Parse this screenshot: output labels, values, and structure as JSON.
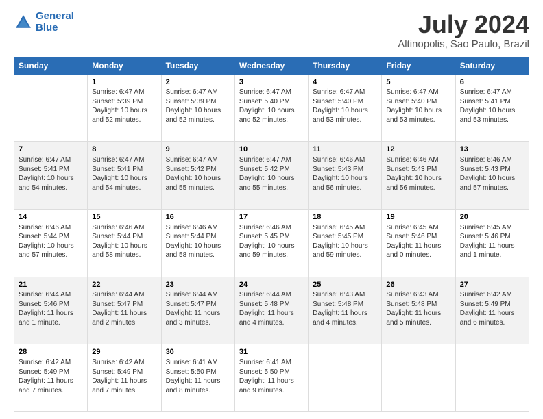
{
  "header": {
    "logo_line1": "General",
    "logo_line2": "Blue",
    "month_year": "July 2024",
    "location": "Altinopolis, Sao Paulo, Brazil"
  },
  "days_of_week": [
    "Sunday",
    "Monday",
    "Tuesday",
    "Wednesday",
    "Thursday",
    "Friday",
    "Saturday"
  ],
  "weeks": [
    [
      {
        "day": "",
        "info": ""
      },
      {
        "day": "1",
        "info": "Sunrise: 6:47 AM\nSunset: 5:39 PM\nDaylight: 10 hours\nand 52 minutes."
      },
      {
        "day": "2",
        "info": "Sunrise: 6:47 AM\nSunset: 5:39 PM\nDaylight: 10 hours\nand 52 minutes."
      },
      {
        "day": "3",
        "info": "Sunrise: 6:47 AM\nSunset: 5:40 PM\nDaylight: 10 hours\nand 52 minutes."
      },
      {
        "day": "4",
        "info": "Sunrise: 6:47 AM\nSunset: 5:40 PM\nDaylight: 10 hours\nand 53 minutes."
      },
      {
        "day": "5",
        "info": "Sunrise: 6:47 AM\nSunset: 5:40 PM\nDaylight: 10 hours\nand 53 minutes."
      },
      {
        "day": "6",
        "info": "Sunrise: 6:47 AM\nSunset: 5:41 PM\nDaylight: 10 hours\nand 53 minutes."
      }
    ],
    [
      {
        "day": "7",
        "info": "Sunrise: 6:47 AM\nSunset: 5:41 PM\nDaylight: 10 hours\nand 54 minutes."
      },
      {
        "day": "8",
        "info": "Sunrise: 6:47 AM\nSunset: 5:41 PM\nDaylight: 10 hours\nand 54 minutes."
      },
      {
        "day": "9",
        "info": "Sunrise: 6:47 AM\nSunset: 5:42 PM\nDaylight: 10 hours\nand 55 minutes."
      },
      {
        "day": "10",
        "info": "Sunrise: 6:47 AM\nSunset: 5:42 PM\nDaylight: 10 hours\nand 55 minutes."
      },
      {
        "day": "11",
        "info": "Sunrise: 6:46 AM\nSunset: 5:43 PM\nDaylight: 10 hours\nand 56 minutes."
      },
      {
        "day": "12",
        "info": "Sunrise: 6:46 AM\nSunset: 5:43 PM\nDaylight: 10 hours\nand 56 minutes."
      },
      {
        "day": "13",
        "info": "Sunrise: 6:46 AM\nSunset: 5:43 PM\nDaylight: 10 hours\nand 57 minutes."
      }
    ],
    [
      {
        "day": "14",
        "info": "Sunrise: 6:46 AM\nSunset: 5:44 PM\nDaylight: 10 hours\nand 57 minutes."
      },
      {
        "day": "15",
        "info": "Sunrise: 6:46 AM\nSunset: 5:44 PM\nDaylight: 10 hours\nand 58 minutes."
      },
      {
        "day": "16",
        "info": "Sunrise: 6:46 AM\nSunset: 5:44 PM\nDaylight: 10 hours\nand 58 minutes."
      },
      {
        "day": "17",
        "info": "Sunrise: 6:46 AM\nSunset: 5:45 PM\nDaylight: 10 hours\nand 59 minutes."
      },
      {
        "day": "18",
        "info": "Sunrise: 6:45 AM\nSunset: 5:45 PM\nDaylight: 10 hours\nand 59 minutes."
      },
      {
        "day": "19",
        "info": "Sunrise: 6:45 AM\nSunset: 5:46 PM\nDaylight: 11 hours\nand 0 minutes."
      },
      {
        "day": "20",
        "info": "Sunrise: 6:45 AM\nSunset: 5:46 PM\nDaylight: 11 hours\nand 1 minute."
      }
    ],
    [
      {
        "day": "21",
        "info": "Sunrise: 6:44 AM\nSunset: 5:46 PM\nDaylight: 11 hours\nand 1 minute."
      },
      {
        "day": "22",
        "info": "Sunrise: 6:44 AM\nSunset: 5:47 PM\nDaylight: 11 hours\nand 2 minutes."
      },
      {
        "day": "23",
        "info": "Sunrise: 6:44 AM\nSunset: 5:47 PM\nDaylight: 11 hours\nand 3 minutes."
      },
      {
        "day": "24",
        "info": "Sunrise: 6:44 AM\nSunset: 5:48 PM\nDaylight: 11 hours\nand 4 minutes."
      },
      {
        "day": "25",
        "info": "Sunrise: 6:43 AM\nSunset: 5:48 PM\nDaylight: 11 hours\nand 4 minutes."
      },
      {
        "day": "26",
        "info": "Sunrise: 6:43 AM\nSunset: 5:48 PM\nDaylight: 11 hours\nand 5 minutes."
      },
      {
        "day": "27",
        "info": "Sunrise: 6:42 AM\nSunset: 5:49 PM\nDaylight: 11 hours\nand 6 minutes."
      }
    ],
    [
      {
        "day": "28",
        "info": "Sunrise: 6:42 AM\nSunset: 5:49 PM\nDaylight: 11 hours\nand 7 minutes."
      },
      {
        "day": "29",
        "info": "Sunrise: 6:42 AM\nSunset: 5:49 PM\nDaylight: 11 hours\nand 7 minutes."
      },
      {
        "day": "30",
        "info": "Sunrise: 6:41 AM\nSunset: 5:50 PM\nDaylight: 11 hours\nand 8 minutes."
      },
      {
        "day": "31",
        "info": "Sunrise: 6:41 AM\nSunset: 5:50 PM\nDaylight: 11 hours\nand 9 minutes."
      },
      {
        "day": "",
        "info": ""
      },
      {
        "day": "",
        "info": ""
      },
      {
        "day": "",
        "info": ""
      }
    ]
  ]
}
